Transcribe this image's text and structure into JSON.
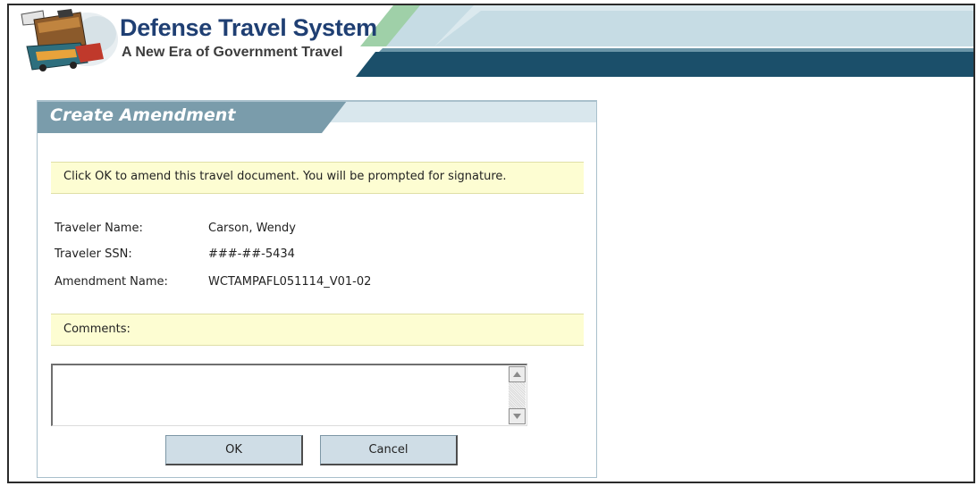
{
  "app": {
    "name": "Defense Travel System",
    "tagline": "A New Era of Government Travel"
  },
  "dialog": {
    "title": "Create Amendment",
    "notice": "Click OK to amend this travel document. You will be prompted for signature.",
    "fields": [
      {
        "label": "Traveler Name:",
        "value": "Carson, Wendy"
      },
      {
        "label": "Traveler SSN:",
        "value": "###-##-5434"
      },
      {
        "label": "Amendment Name:",
        "value": "WCTAMPAFL051114_V01-02"
      }
    ],
    "comments_label": "Comments:",
    "comments_value": "",
    "ok_label": "OK",
    "cancel_label": "Cancel"
  },
  "colors": {
    "brand_navy": "#1f3f73",
    "banner_teal": "#1b4f6a",
    "banner_light": "#c8dde5",
    "banner_green": "#8fc79a",
    "dialog_header": "#7a9cab",
    "notice_bg": "#fdfdd2",
    "button_bg": "#cfdde6"
  },
  "icons": [
    "dts-logo",
    "scroll-up-arrow-icon",
    "scroll-down-arrow-icon"
  ]
}
